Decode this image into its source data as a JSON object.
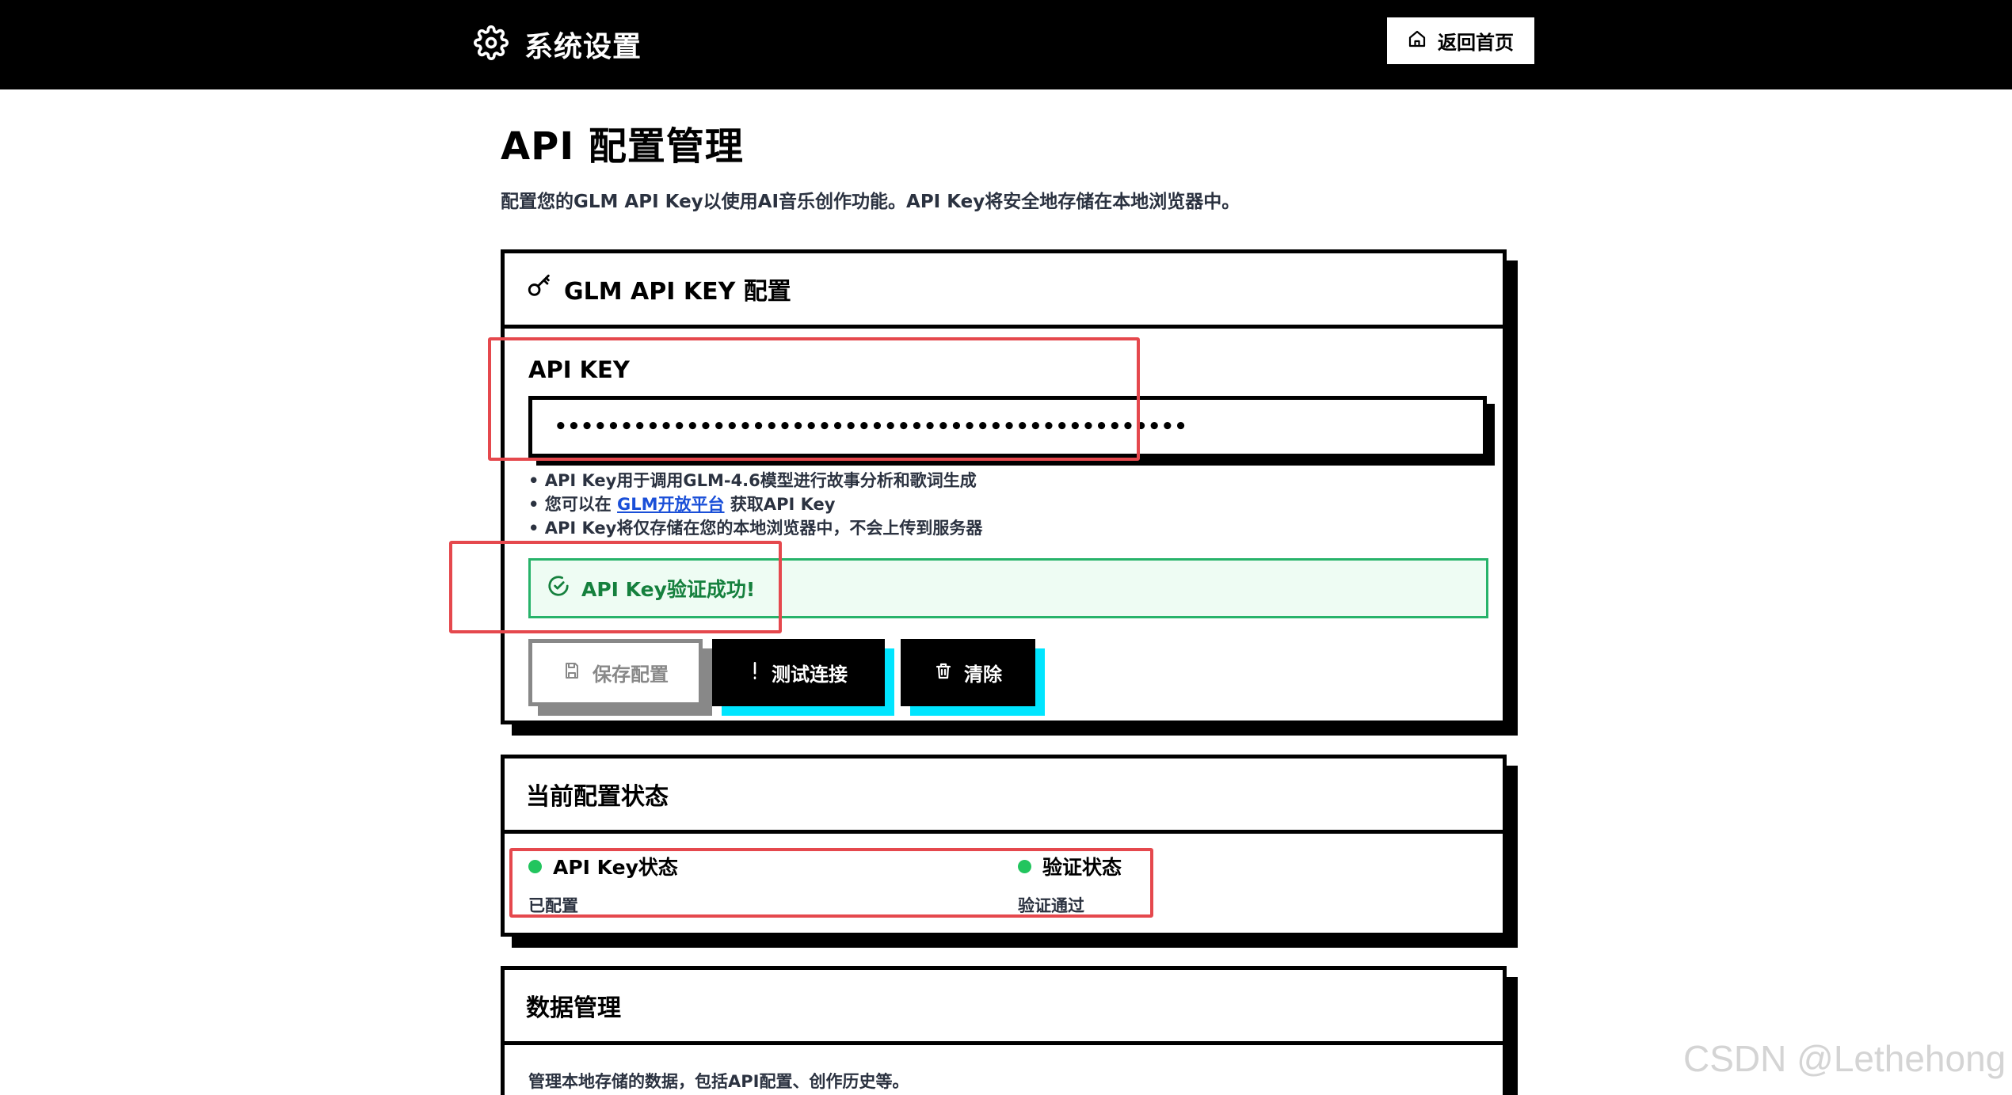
{
  "topbar": {
    "title": "系统设置",
    "home_button": "返回首页"
  },
  "page": {
    "title": "API 配置管理",
    "description": "配置您的GLM API Key以使用AI音乐创作功能。API Key将安全地存储在本地浏览器中。"
  },
  "api_card": {
    "header": "GLM API KEY 配置",
    "field_label": "API KEY",
    "input_value": "••••••••••••••••••••••••••••••••••••••••••••••••",
    "tips": [
      "• API Key用于调用GLM-4.6模型进行故事分析和歌词生成",
      "• 您可以在 ",
      "GLM开放平台",
      " 获取API Key",
      "• API Key将仅存储在您的本地浏览器中，不会上传到服务器"
    ],
    "success_message": "API Key验证成功!",
    "buttons": {
      "save": "保存配置",
      "test": "测试连接",
      "clear": "清除"
    }
  },
  "status_card": {
    "header": "当前配置状态",
    "api_key_status_label": "API Key状态",
    "api_key_status_value": "已配置",
    "verify_status_label": "验证状态",
    "verify_status_value": "验证通过",
    "status_color": "#22c55e"
  },
  "data_card": {
    "header": "数据管理",
    "description": "管理本地存储的数据，包括API配置、创作历史等。"
  },
  "watermark": "CSDN @Lethehong"
}
